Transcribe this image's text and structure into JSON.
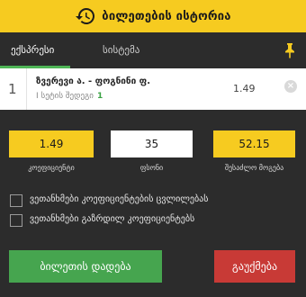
{
  "header": {
    "title": "ბილეთების ისტორია",
    "icon": "history-icon"
  },
  "tabs": {
    "express": "ექსპრესი",
    "system": "სისტემა",
    "pin_icon": "pin-icon"
  },
  "bet": {
    "index": "1",
    "event": "ზვერევი ა. - ფოგნინი ფ.",
    "market": "I სეტის შედეგი",
    "outcome": "1",
    "odd": "1.49",
    "close_icon": "close-icon"
  },
  "summary": {
    "coefficient": "1.49",
    "stake": "35",
    "possible_win": "52.15",
    "coefficient_label": "კოეფიციენტი",
    "stake_label": "ფსონი",
    "possible_win_label": "შესაძლო მოგება"
  },
  "options": {
    "accept_changes": "ვეთანხმები კოეფიციენტების ცვლილებას",
    "accept_increased": "ვეთანხმები გაზრდილ კოეფიციენტებს"
  },
  "buttons": {
    "place": "ბილეთის დადება",
    "cancel": "გაუქმება"
  },
  "colors": {
    "accent": "#f6cb20",
    "green": "#46a54f",
    "red": "#c83a36",
    "background": "#2c2c2c"
  }
}
